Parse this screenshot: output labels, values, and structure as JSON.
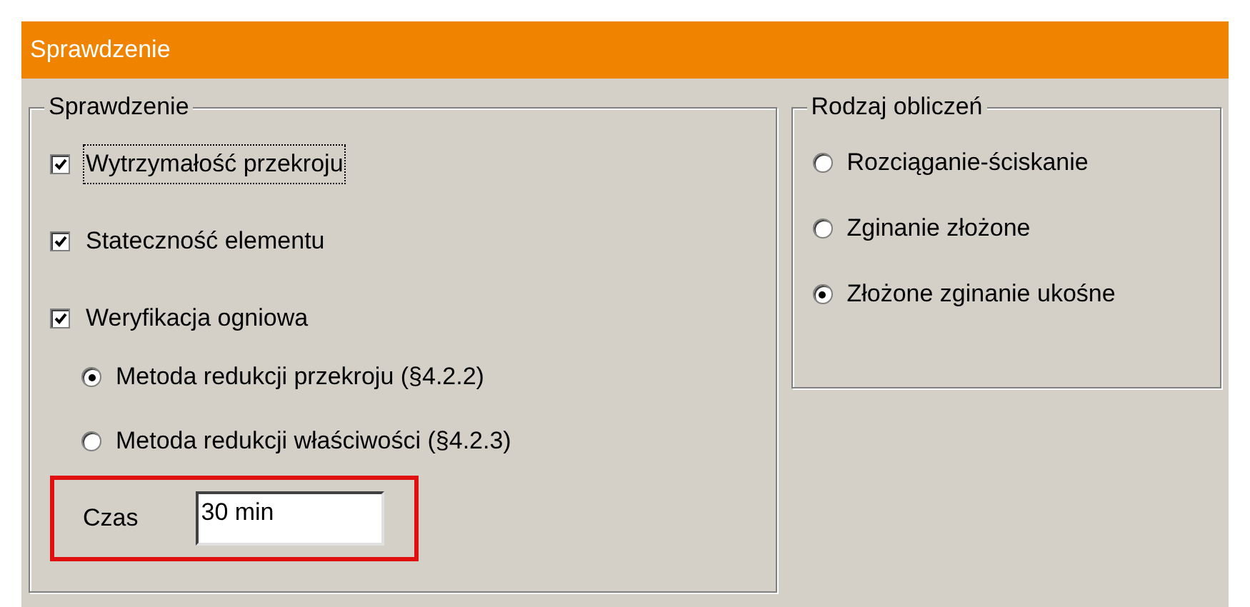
{
  "header": {
    "title": "Sprawdzenie"
  },
  "checks": {
    "title": "Sprawdzenie",
    "checkboxes": [
      {
        "label": "Wytrzymałość przekroju",
        "checked": true,
        "focused": true
      },
      {
        "label": "Stateczność elementu",
        "checked": true,
        "focused": false
      },
      {
        "label": "Weryfikacja ogniowa",
        "checked": true,
        "focused": false
      }
    ],
    "fire_methods": [
      {
        "label": "Metoda redukcji przekroju (§4.2.2)",
        "selected": true
      },
      {
        "label": "Metoda redukcji właściwości (§4.2.3)",
        "selected": false
      }
    ],
    "time": {
      "label": "Czas",
      "value": "30 min",
      "highlighted": true
    }
  },
  "calculation_type": {
    "title": "Rodzaj obliczeń",
    "options": [
      {
        "label": "Rozciąganie-ściskanie",
        "selected": false
      },
      {
        "label": "Zginanie złożone",
        "selected": false
      },
      {
        "label": "Złożone zginanie ukośne",
        "selected": true
      }
    ]
  }
}
